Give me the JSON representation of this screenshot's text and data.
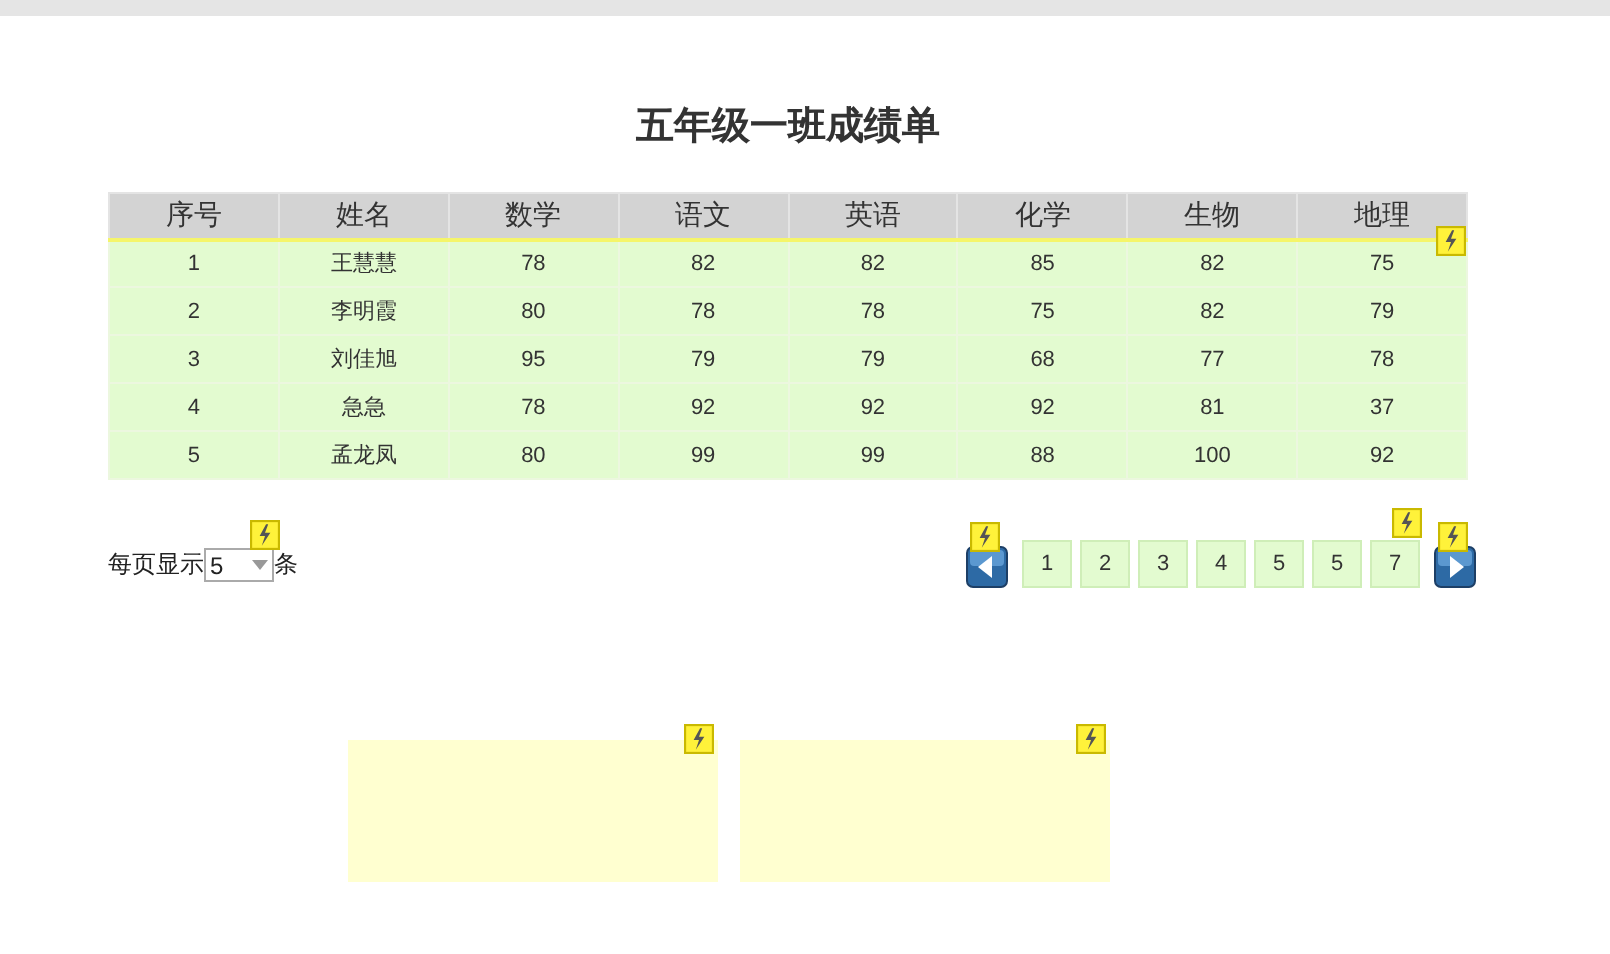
{
  "title": "五年级一班成绩单",
  "table": {
    "columns": [
      "序号",
      "姓名",
      "数学",
      "语文",
      "英语",
      "化学",
      "生物",
      "地理"
    ],
    "rows": [
      [
        "1",
        "王慧慧",
        "78",
        "82",
        "82",
        "85",
        "82",
        "75"
      ],
      [
        "2",
        "李明霞",
        "80",
        "78",
        "78",
        "75",
        "82",
        "79"
      ],
      [
        "3",
        "刘佳旭",
        "95",
        "79",
        "79",
        "68",
        "77",
        "78"
      ],
      [
        "4",
        "急急",
        "78",
        "92",
        "92",
        "92",
        "81",
        "37"
      ],
      [
        "5",
        "孟龙凤",
        "80",
        "99",
        "99",
        "88",
        "100",
        "92"
      ]
    ]
  },
  "page_size": {
    "before": "每页显示",
    "value": "5",
    "after": "条"
  },
  "pages": [
    "1",
    "2",
    "3",
    "4",
    "5",
    "5",
    "7"
  ]
}
